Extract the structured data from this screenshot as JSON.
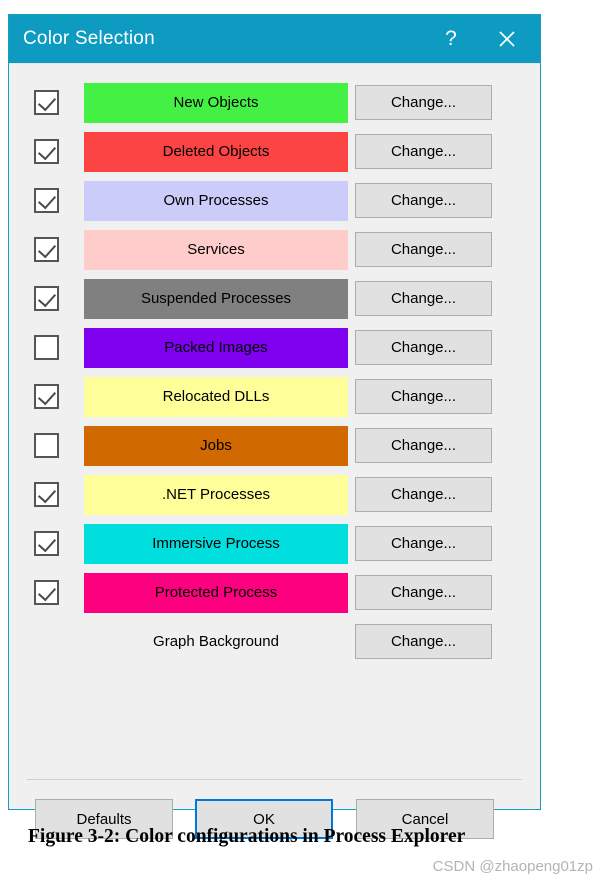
{
  "dialog": {
    "title": "Color Selection",
    "help_icon": "question-mark-icon",
    "close_icon": "close-icon",
    "accent_color": "#0d9bc2",
    "background_color": "#f0f0f0"
  },
  "rows": [
    {
      "label": "New Objects",
      "color": "#44f044",
      "checked": true,
      "has_checkbox": true,
      "change_label": "Change..."
    },
    {
      "label": "Deleted Objects",
      "color": "#fc4444",
      "checked": true,
      "has_checkbox": true,
      "change_label": "Change..."
    },
    {
      "label": "Own Processes",
      "color": "#ccccfa",
      "checked": true,
      "has_checkbox": true,
      "change_label": "Change..."
    },
    {
      "label": "Services",
      "color": "#ffcccc",
      "checked": true,
      "has_checkbox": true,
      "change_label": "Change..."
    },
    {
      "label": "Suspended Processes",
      "color": "#808080",
      "checked": true,
      "has_checkbox": true,
      "change_label": "Change..."
    },
    {
      "label": "Packed Images",
      "color": "#8000f0",
      "checked": false,
      "has_checkbox": true,
      "change_label": "Change..."
    },
    {
      "label": "Relocated DLLs",
      "color": "#ffff99",
      "checked": true,
      "has_checkbox": true,
      "change_label": "Change..."
    },
    {
      "label": "Jobs",
      "color": "#d06a00",
      "checked": false,
      "has_checkbox": true,
      "change_label": "Change..."
    },
    {
      "label": ".NET Processes",
      "color": "#ffff99",
      "checked": true,
      "has_checkbox": true,
      "change_label": "Change..."
    },
    {
      "label": "Immersive Process",
      "color": "#00dede",
      "checked": true,
      "has_checkbox": true,
      "change_label": "Change..."
    },
    {
      "label": "Protected Process",
      "color": "#fc0080",
      "checked": true,
      "has_checkbox": true,
      "change_label": "Change..."
    },
    {
      "label": "Graph Background",
      "color": "transparent",
      "checked": false,
      "has_checkbox": false,
      "change_label": "Change..."
    }
  ],
  "footer": {
    "defaults_label": "Defaults",
    "ok_label": "OK",
    "cancel_label": "Cancel",
    "focus_color": "#0078d7"
  },
  "caption": "Figure 3-2: Color configurations in Process Explorer",
  "watermark": "CSDN @zhaopeng01zp"
}
